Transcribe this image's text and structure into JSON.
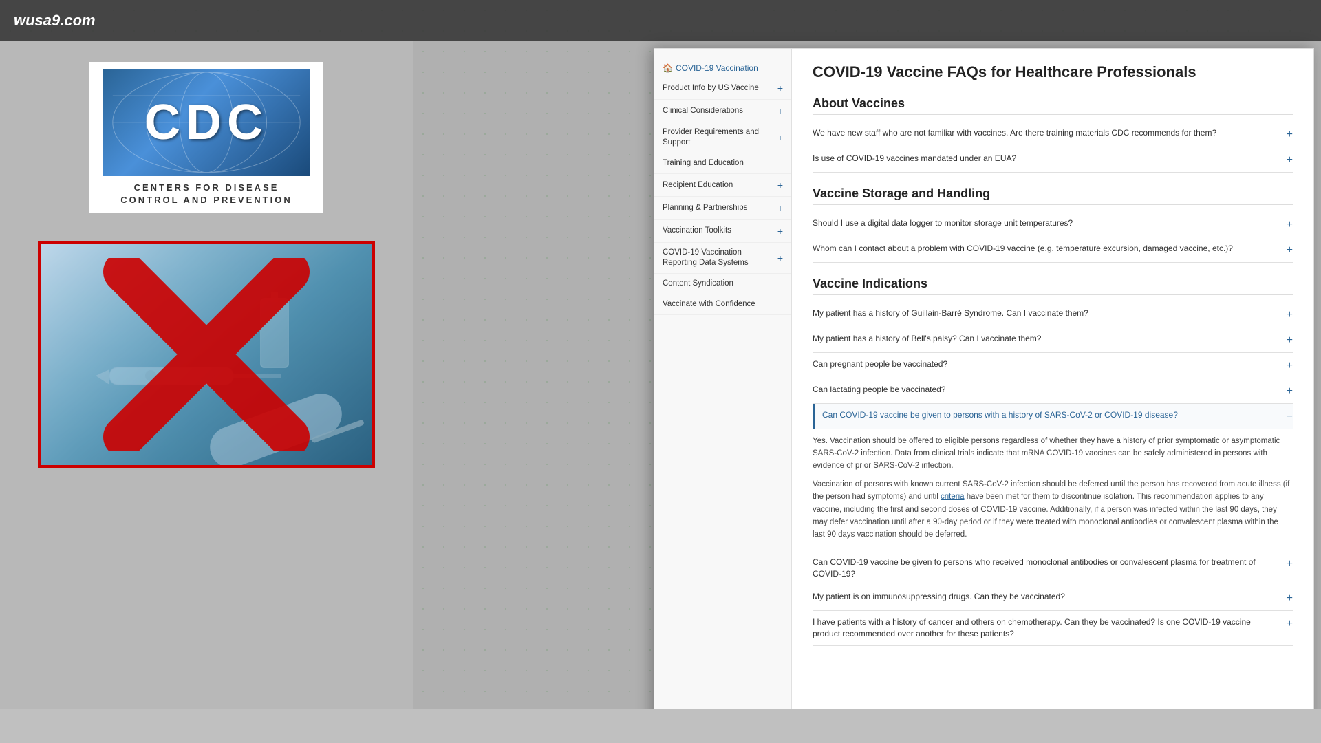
{
  "topBar": {
    "logo": "wusa9.com"
  },
  "cdcLogo": {
    "acronym": "CDC",
    "subtitle_line1": "CENTERS FOR DISEASE",
    "subtitle_line2": "CONTROL AND PREVENTION"
  },
  "websitePanel": {
    "pageTitle": "COVID-19 Vaccine FAQs for Healthcare Professionals",
    "sidebar": {
      "homeItem": "COVID-19 Vaccination",
      "items": [
        {
          "label": "Product Info by US Vaccine",
          "hasPlus": true
        },
        {
          "label": "Clinical Considerations",
          "hasPlus": true
        },
        {
          "label": "Provider Requirements and Support",
          "hasPlus": true
        },
        {
          "label": "Training and Education",
          "hasPlus": false
        },
        {
          "label": "Recipient Education",
          "hasPlus": true
        },
        {
          "label": "Planning & Partnerships",
          "hasPlus": true
        },
        {
          "label": "Vaccination Toolkits",
          "hasPlus": true
        },
        {
          "label": "COVID-19 Vaccination Reporting Data Systems",
          "hasPlus": true
        },
        {
          "label": "Content Syndication",
          "hasPlus": false
        },
        {
          "label": "Vaccinate with Confidence",
          "hasPlus": false
        }
      ]
    },
    "sections": [
      {
        "title": "About Vaccines",
        "faqs": [
          {
            "question": "We have new staff who are not familiar with vaccines. Are there training materials CDC recommends for them?",
            "expanded": false,
            "answer": ""
          },
          {
            "question": "Is use of COVID-19 vaccines mandated under an EUA?",
            "expanded": false,
            "answer": ""
          }
        ]
      },
      {
        "title": "Vaccine Storage and Handling",
        "faqs": [
          {
            "question": "Should I use a digital data logger to monitor storage unit temperatures?",
            "expanded": false,
            "answer": ""
          },
          {
            "question": "Whom can I contact about a problem with COVID-19 vaccine (e.g. temperature excursion, damaged vaccine, etc.)?",
            "expanded": false,
            "answer": ""
          }
        ]
      },
      {
        "title": "Vaccine Indications",
        "faqs": [
          {
            "question": "My patient has a history of Guillain-Barré Syndrome. Can I vaccinate them?",
            "expanded": false,
            "answer": ""
          },
          {
            "question": "My patient has a history of Bell's palsy? Can I vaccinate them?",
            "expanded": false,
            "answer": ""
          },
          {
            "question": "Can pregnant people be vaccinated?",
            "expanded": false,
            "answer": ""
          },
          {
            "question": "Can lactating people be vaccinated?",
            "expanded": false,
            "answer": ""
          },
          {
            "question": "Can COVID-19 vaccine be given to persons with a history of SARS-CoV-2 or COVID-19 disease?",
            "expanded": true,
            "answer_para1": "Yes. Vaccination should be offered to eligible persons regardless of whether they have a history of prior symptomatic or asymptomatic SARS-CoV-2 infection. Data from clinical trials indicate that mRNA COVID-19 vaccines can be safely administered in persons with evidence of prior SARS-CoV-2 infection.",
            "answer_para2": "Vaccination of persons with known current SARS-CoV-2 infection should be deferred until the person has recovered from acute illness (if the person had symptoms) and until criteria have been met for them to discontinue isolation. This recommendation applies to any vaccine, including the first and second doses of COVID-19 vaccine. Additionally, if a person was infected within the last 90 days, they may defer vaccination until after a 90-day period or if they were treated with monoclonal antibodies or convalescent plasma within the last 90 days vaccination should be deferred.",
            "link_text": "criteria"
          },
          {
            "question": "Can COVID-19 vaccine be given to persons who received monoclonal antibodies or convalescent plasma for treatment of COVID-19?",
            "expanded": false,
            "answer": ""
          },
          {
            "question": "My patient is on immunosuppressing drugs. Can they be vaccinated?",
            "expanded": false,
            "answer": ""
          },
          {
            "question": "I have patients with a history of cancer and others on chemotherapy. Can they be vaccinated? Is one COVID-19 vaccine product recommended over another for these patients?",
            "expanded": false,
            "answer": ""
          }
        ]
      }
    ]
  }
}
